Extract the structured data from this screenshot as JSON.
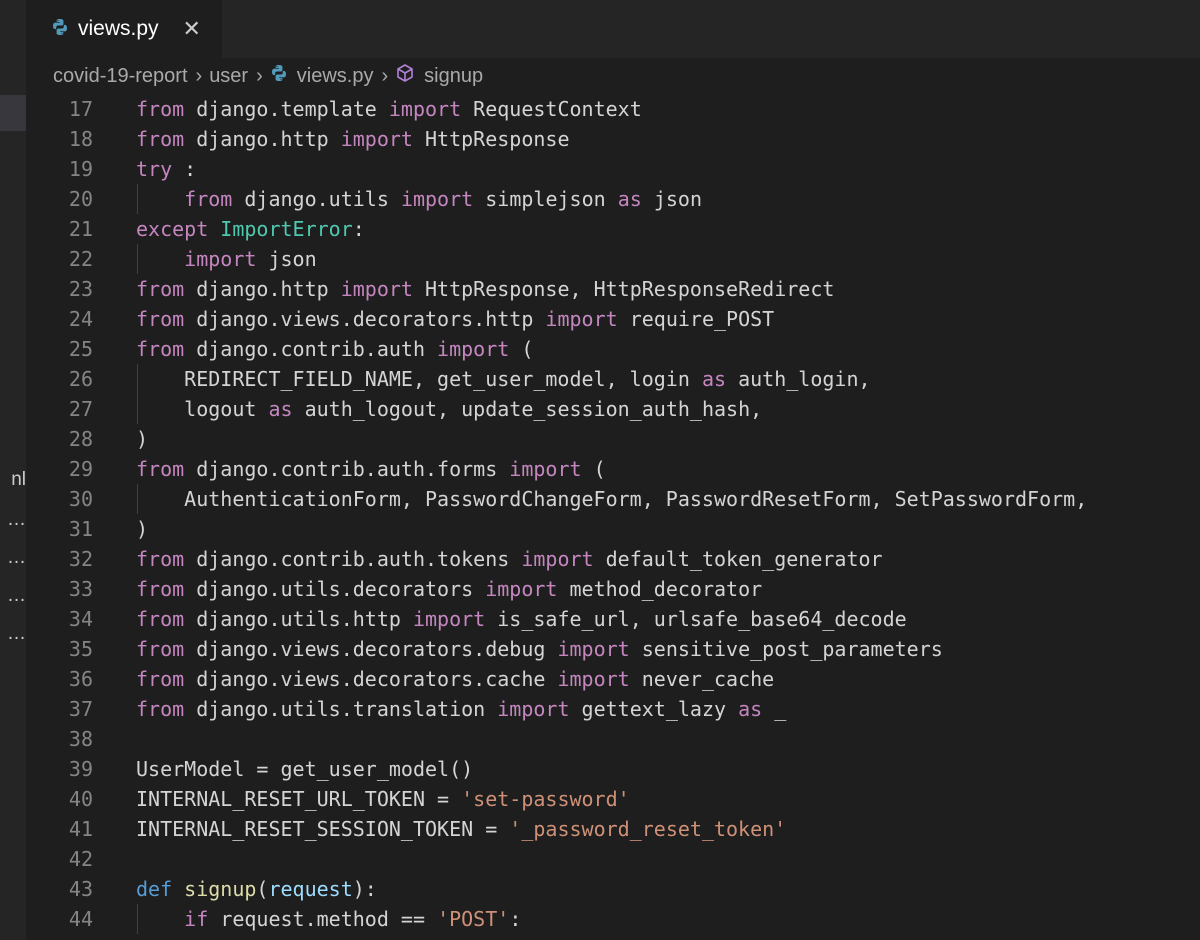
{
  "tab": {
    "label": "views.py",
    "close": "✕"
  },
  "breadcrumb": {
    "folder": "covid-19-report",
    "subfolder": "user",
    "file": "views.py",
    "symbol": "signup"
  },
  "sidebar_fragments": [
    "nl",
    "…",
    "…",
    "…",
    "…"
  ],
  "colors": {
    "editor_bg": "#1e1e1e",
    "tabbar_bg": "#252526",
    "keyword": "#c586c0",
    "def_keyword": "#569cd6",
    "function": "#dcdcaa",
    "class": "#4ec9b0",
    "string": "#ce9178",
    "parameter": "#9cdcfe",
    "line_number": "#858585"
  },
  "code": [
    {
      "n": "17",
      "t": [
        [
          "kw",
          "from"
        ],
        [
          "",
          "django.template "
        ],
        [
          "kw",
          "import"
        ],
        [
          "",
          "RequestContext"
        ]
      ]
    },
    {
      "n": "18",
      "t": [
        [
          "kw",
          "from"
        ],
        [
          "",
          "django.http "
        ],
        [
          "kw",
          "import"
        ],
        [
          "",
          "HttpResponse"
        ]
      ]
    },
    {
      "n": "19",
      "t": [
        [
          "kw",
          "try"
        ],
        [
          "",
          ":"
        ]
      ]
    },
    {
      "n": "20",
      "guide": true,
      "t": [
        [
          "",
          "    "
        ],
        [
          "kw",
          "from"
        ],
        [
          "",
          "django.utils "
        ],
        [
          "kw",
          "import"
        ],
        [
          "",
          "simplejson "
        ],
        [
          "kw",
          "as"
        ],
        [
          "",
          "json"
        ]
      ]
    },
    {
      "n": "21",
      "t": [
        [
          "kw",
          "except"
        ],
        [
          "",
          ""
        ],
        [
          "cls",
          "ImportError"
        ],
        [
          "",
          ":"
        ]
      ]
    },
    {
      "n": "22",
      "guide": true,
      "t": [
        [
          "",
          "    "
        ],
        [
          "kw",
          "import"
        ],
        [
          "",
          "json"
        ]
      ]
    },
    {
      "n": "23",
      "t": [
        [
          "kw",
          "from"
        ],
        [
          "",
          "django.http "
        ],
        [
          "kw",
          "import"
        ],
        [
          "",
          "HttpResponse, HttpResponseRedirect"
        ]
      ]
    },
    {
      "n": "24",
      "t": [
        [
          "kw",
          "from"
        ],
        [
          "",
          "django.views.decorators.http "
        ],
        [
          "kw",
          "import"
        ],
        [
          "",
          "require_POST"
        ]
      ]
    },
    {
      "n": "25",
      "t": [
        [
          "kw",
          "from"
        ],
        [
          "",
          "django.contrib.auth "
        ],
        [
          "kw",
          "import"
        ],
        [
          "",
          "("
        ]
      ]
    },
    {
      "n": "26",
      "guide": true,
      "t": [
        [
          "",
          "    REDIRECT_FIELD_NAME, get_user_model, login "
        ],
        [
          "kw",
          "as"
        ],
        [
          "",
          "auth_login,"
        ]
      ]
    },
    {
      "n": "27",
      "guide": true,
      "t": [
        [
          "",
          "    logout "
        ],
        [
          "kw",
          "as"
        ],
        [
          "",
          "auth_logout, update_session_auth_hash,"
        ]
      ]
    },
    {
      "n": "28",
      "t": [
        [
          "",
          ")"
        ]
      ]
    },
    {
      "n": "29",
      "t": [
        [
          "kw",
          "from"
        ],
        [
          "",
          "django.contrib.auth.forms "
        ],
        [
          "kw",
          "import"
        ],
        [
          "",
          "("
        ]
      ]
    },
    {
      "n": "30",
      "guide": true,
      "t": [
        [
          "",
          "    AuthenticationForm, PasswordChangeForm, PasswordResetForm, SetPasswordForm,"
        ]
      ]
    },
    {
      "n": "31",
      "t": [
        [
          "",
          ")"
        ]
      ]
    },
    {
      "n": "32",
      "t": [
        [
          "kw",
          "from"
        ],
        [
          "",
          "django.contrib.auth.tokens "
        ],
        [
          "kw",
          "import"
        ],
        [
          "",
          "default_token_generator"
        ]
      ]
    },
    {
      "n": "33",
      "t": [
        [
          "kw",
          "from"
        ],
        [
          "",
          "django.utils.decorators "
        ],
        [
          "kw",
          "import"
        ],
        [
          "",
          "method_decorator"
        ]
      ]
    },
    {
      "n": "34",
      "t": [
        [
          "kw",
          "from"
        ],
        [
          "",
          "django.utils.http "
        ],
        [
          "kw",
          "import"
        ],
        [
          "",
          "is_safe_url, urlsafe_base64_decode"
        ]
      ]
    },
    {
      "n": "35",
      "t": [
        [
          "kw",
          "from"
        ],
        [
          "",
          "django.views.decorators.debug "
        ],
        [
          "kw",
          "import"
        ],
        [
          "",
          "sensitive_post_parameters"
        ]
      ]
    },
    {
      "n": "36",
      "t": [
        [
          "kw",
          "from"
        ],
        [
          "",
          "django.views.decorators.cache "
        ],
        [
          "kw",
          "import"
        ],
        [
          "",
          "never_cache"
        ]
      ]
    },
    {
      "n": "37",
      "t": [
        [
          "kw",
          "from"
        ],
        [
          "",
          "django.utils.translation "
        ],
        [
          "kw",
          "import"
        ],
        [
          "",
          "gettext_lazy "
        ],
        [
          "kw",
          "as"
        ],
        [
          "",
          "_"
        ]
      ]
    },
    {
      "n": "38",
      "t": []
    },
    {
      "n": "39",
      "t": [
        [
          "",
          "UserModel = get_user_model()"
        ]
      ]
    },
    {
      "n": "40",
      "t": [
        [
          "",
          "INTERNAL_RESET_URL_TOKEN = "
        ],
        [
          "str",
          "'set-password'"
        ]
      ]
    },
    {
      "n": "41",
      "t": [
        [
          "",
          "INTERNAL_RESET_SESSION_TOKEN = "
        ],
        [
          "str",
          "'_password_reset_token'"
        ]
      ]
    },
    {
      "n": "42",
      "t": []
    },
    {
      "n": "43",
      "t": [
        [
          "def",
          "def"
        ],
        [
          "",
          ""
        ],
        [
          "fn",
          "signup"
        ],
        [
          "",
          "("
        ],
        [
          "prm",
          "request"
        ],
        [
          "",
          "):"
        ]
      ]
    },
    {
      "n": "44",
      "guide": true,
      "t": [
        [
          "",
          "    "
        ],
        [
          "kw",
          "if"
        ],
        [
          "",
          "request.method == "
        ],
        [
          "str",
          "'POST'"
        ],
        [
          "",
          ":"
        ]
      ]
    }
  ]
}
